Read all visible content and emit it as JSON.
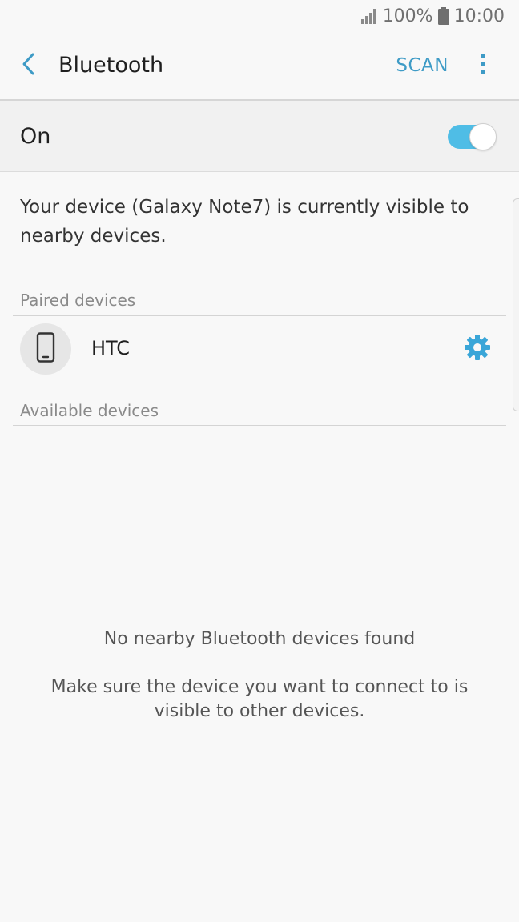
{
  "status_bar": {
    "battery_percent": "100%",
    "time": "10:00",
    "icons": [
      "signal-icon",
      "battery-icon"
    ]
  },
  "app_bar": {
    "title": "Bluetooth",
    "scan_label": "SCAN",
    "icons": [
      "back-arrow-icon",
      "more-vert-icon"
    ]
  },
  "bluetooth_switch": {
    "label": "On",
    "enabled": true
  },
  "visibility_message": "Your device (Galaxy Note7) is currently visible to nearby devices.",
  "paired_devices": {
    "header": "Paired devices",
    "items": [
      {
        "name": "HTC",
        "icon": "smartphone-icon",
        "action_icon": "gear-icon"
      }
    ]
  },
  "available_devices": {
    "header": "Available devices",
    "empty_title": "No nearby Bluetooth devices found",
    "empty_description": "Make sure the device you want to connect to is visible to other devices."
  },
  "colors": {
    "accent": "#3e9bc6",
    "toggle_on": "#4fbde6",
    "background": "#f8f8f8"
  }
}
